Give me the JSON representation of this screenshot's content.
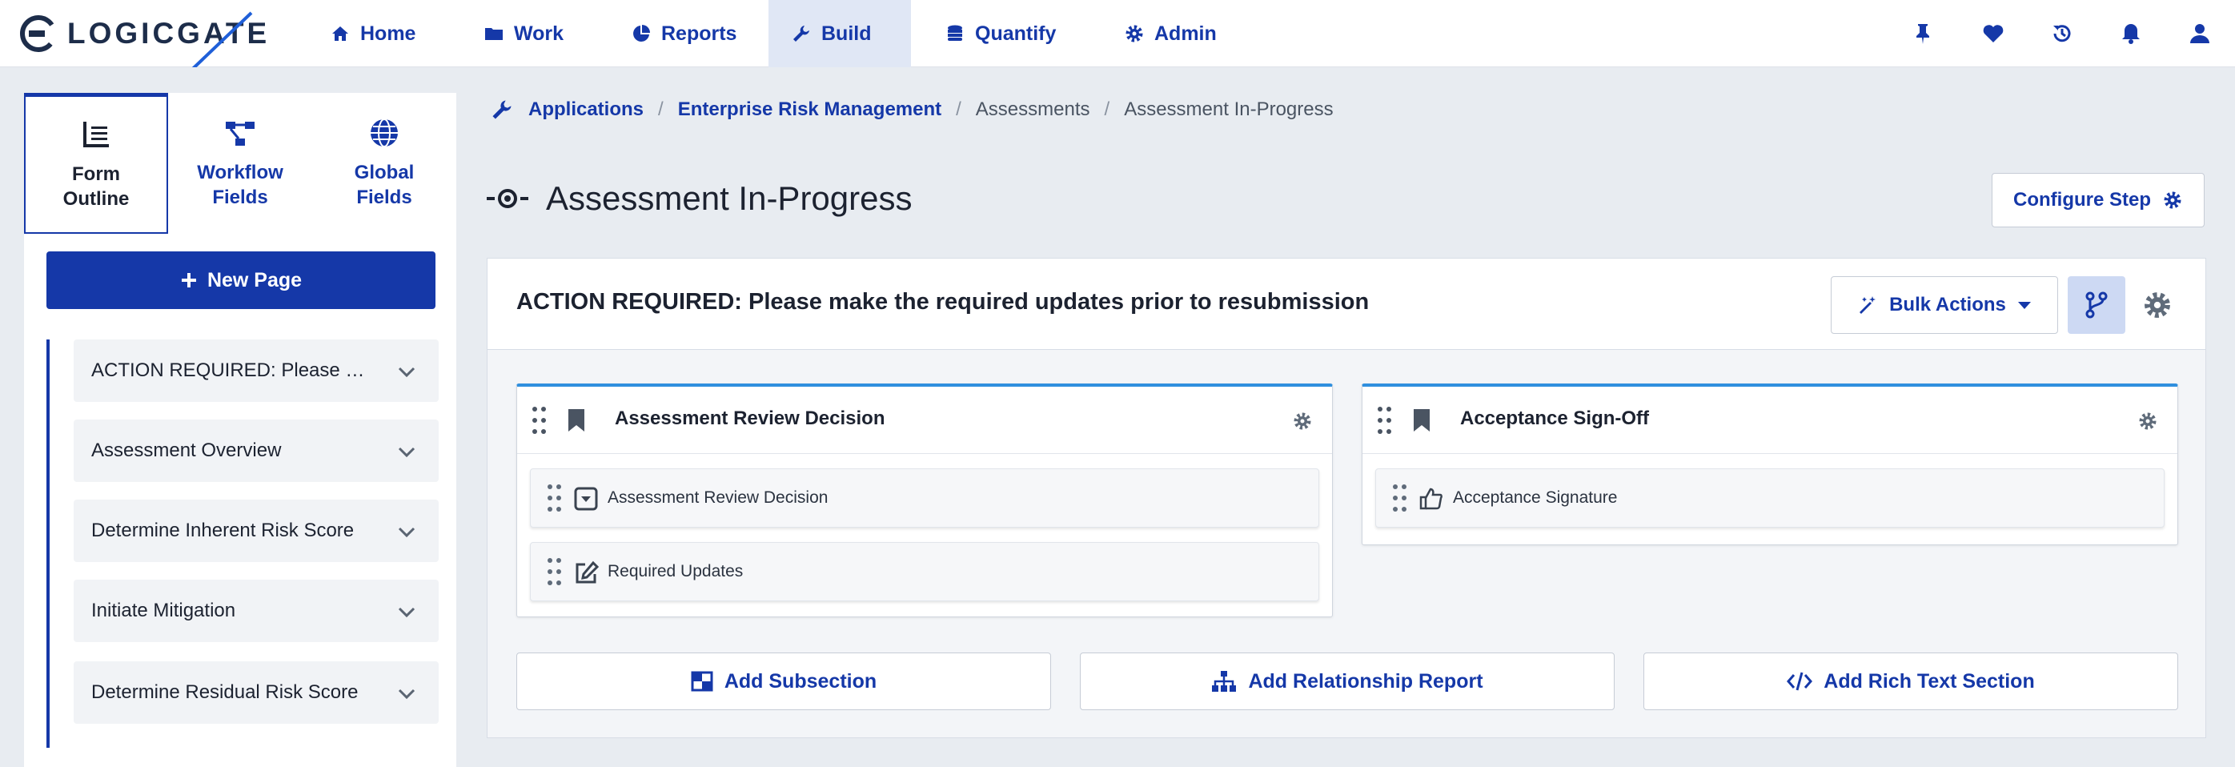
{
  "app": {
    "brand": "LOGICGATE"
  },
  "nav": {
    "items": [
      {
        "label": "Home",
        "icon": "home-icon"
      },
      {
        "label": "Work",
        "icon": "folder-icon"
      },
      {
        "label": "Reports",
        "icon": "pie-chart-icon"
      },
      {
        "label": "Build",
        "icon": "wrench-icon",
        "active": true
      },
      {
        "label": "Quantify",
        "icon": "coins-icon"
      },
      {
        "label": "Admin",
        "icon": "gear-icon"
      }
    ],
    "tools": [
      "pin-icon",
      "heart-icon",
      "history-icon",
      "bell-icon",
      "user-icon"
    ]
  },
  "sidebar": {
    "tabs": [
      {
        "label": "Form Outline",
        "icon": "outline-icon",
        "active": true
      },
      {
        "label": "Workflow Fields",
        "icon": "workflow-icon"
      },
      {
        "label": "Global Fields",
        "icon": "globe-icon"
      }
    ],
    "new_page_label": "New Page",
    "pages": [
      {
        "label": "ACTION REQUIRED: Please make the required updates prior to resubmission"
      },
      {
        "label": "Assessment Overview"
      },
      {
        "label": "Determine Inherent Risk Score"
      },
      {
        "label": "Initiate Mitigation"
      },
      {
        "label": "Determine Residual Risk Score"
      }
    ]
  },
  "breadcrumb": [
    "Applications",
    "Enterprise Risk Management",
    "Assessments",
    "Assessment In-Progress"
  ],
  "page": {
    "title": "Assessment In-Progress",
    "configure_label": "Configure Step"
  },
  "section": {
    "title": "ACTION REQUIRED: Please make the required updates prior to resubmission",
    "bulk_actions_label": "Bulk Actions",
    "subsections": [
      {
        "title": "Assessment Review Decision",
        "fields": [
          {
            "label": "Assessment Review Decision",
            "icon": "dropdown-field-icon"
          },
          {
            "label": "Required Updates",
            "icon": "edit-field-icon"
          }
        ]
      },
      {
        "title": "Acceptance Sign-Off",
        "fields": [
          {
            "label": "Acceptance Signature",
            "icon": "thumbs-up-icon"
          }
        ]
      }
    ],
    "add_buttons": [
      {
        "label": "Add Subsection",
        "icon": "subsection-icon"
      },
      {
        "label": "Add Relationship Report",
        "icon": "sitemap-icon"
      },
      {
        "label": "Add Rich Text Section",
        "icon": "code-icon"
      }
    ]
  },
  "colors": {
    "primary": "#1538a8",
    "accent_border": "#2f8fde",
    "annotation_arrow": "#1f5fd8"
  }
}
